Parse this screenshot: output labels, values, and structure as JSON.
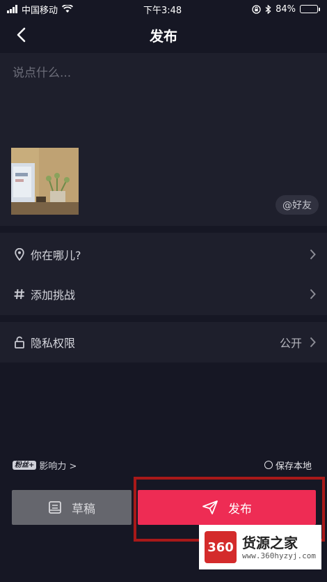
{
  "status_bar": {
    "carrier": "中国移动",
    "time": "下午3:48",
    "battery_percent": "84%",
    "battery_level": 0.84
  },
  "nav": {
    "title": "发布"
  },
  "compose": {
    "caption_placeholder": "说点什么...",
    "mention_label": "@好友"
  },
  "options": {
    "location_label": "你在哪儿?",
    "challenge_label": "添加挑战"
  },
  "privacy": {
    "label": "隐私权限",
    "value": "公开"
  },
  "footer": {
    "fan_logo": "粉丝+",
    "influence_label": "影响力 >",
    "save_local_label": "保存本地"
  },
  "actions": {
    "draft_label": "草稿",
    "publish_label": "发布"
  },
  "watermark": {
    "badge": "360",
    "title": "货源之家",
    "url": "www.360hyzyj.com"
  },
  "colors": {
    "background": "#161724",
    "card": "#1e1f2c",
    "publish": "#ee2c54",
    "draft": "#65666d",
    "highlight": "#a81919"
  }
}
